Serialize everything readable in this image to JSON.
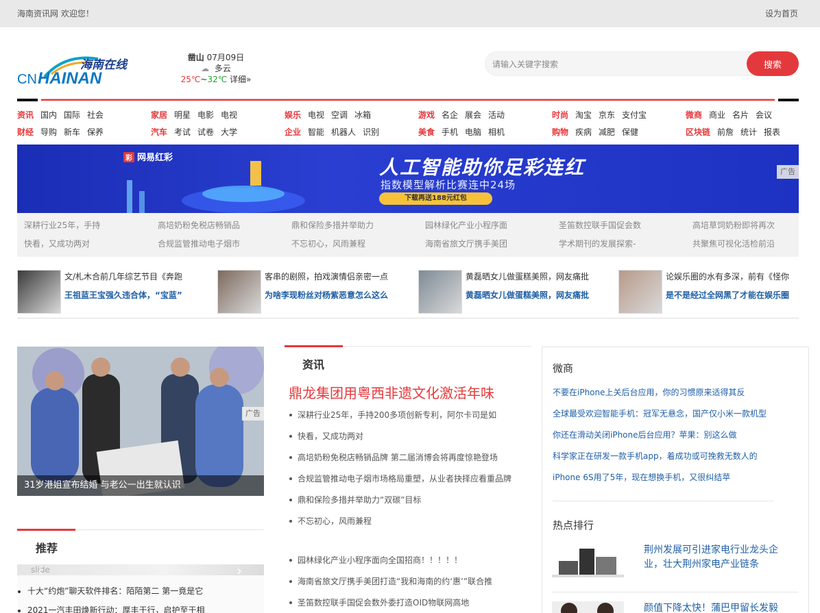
{
  "topbar": {
    "welcome": "海南资讯网  欢迎您！",
    "homepage": "设为首页"
  },
  "logo": {
    "cn": "CN",
    "hainan": "HAINAN",
    "zh": "海南在线"
  },
  "weather": {
    "city": "凿山",
    "date": "07月09日",
    "condition": "多云",
    "low": "25℃",
    "sep": "~",
    "high": "32℃",
    "detail": "详细»"
  },
  "search": {
    "placeholder": "请输入关键字搜索",
    "button": "搜索"
  },
  "nav": [
    {
      "rows": [
        {
          "head": "资讯",
          "items": [
            "国内",
            "国际",
            "社会"
          ]
        },
        {
          "head": "财经",
          "items": [
            "导购",
            "新车",
            "保养"
          ]
        }
      ]
    },
    {
      "rows": [
        {
          "head": "家居",
          "items": [
            "明星",
            "电影",
            "电视"
          ]
        },
        {
          "head": "汽车",
          "items": [
            "考试",
            "试卷",
            "大学"
          ]
        }
      ]
    },
    {
      "rows": [
        {
          "head": "娱乐",
          "items": [
            "电视",
            "空调",
            "冰箱"
          ]
        },
        {
          "head": "企业",
          "items": [
            "智能",
            "机器人",
            "识别"
          ]
        }
      ]
    },
    {
      "rows": [
        {
          "head": "游戏",
          "items": [
            "名企",
            "展会",
            "活动"
          ]
        },
        {
          "head": "美食",
          "items": [
            "手机",
            "电脑",
            "相机"
          ]
        }
      ]
    },
    {
      "rows": [
        {
          "head": "时尚",
          "items": [
            "淘宝",
            "京东",
            "支付宝"
          ]
        },
        {
          "head": "购物",
          "items": [
            "疾病",
            "减肥",
            "保健"
          ]
        }
      ]
    },
    {
      "rows": [
        {
          "head": "微商",
          "items": [
            "商业",
            "名片",
            "会议"
          ]
        },
        {
          "head": "区块链",
          "items": [
            "前詹",
            "统计",
            "报表"
          ]
        }
      ]
    }
  ],
  "banner": {
    "tag": "彩",
    "brand": "网易红彩",
    "headline": "人工智能助你足彩连红",
    "sub": "指数模型解析比赛连中24场",
    "cta": "下载再送188元红包",
    "ad": "广告"
  },
  "links": [
    [
      "深耕行业25年，手持",
      "快看，又成功两对"
    ],
    [
      "高培奶粉免税店畅销品",
      "合规监管推动电子烟市"
    ],
    [
      "鼎和保险多措并举助力",
      "不忘初心，风雨兼程"
    ],
    [
      "园林绿化产业小程序面",
      "海南省旅文厅携手美团"
    ],
    [
      "圣笛数控联手国促会数",
      "学术期刊的发展探索-"
    ],
    [
      "高培草饲奶粉即将再次",
      "共聚焦可视化活检前沿"
    ]
  ],
  "thumbs": [
    {
      "t1": "文/札木合前几年综艺节目《奔跑",
      "t2": "王祖蓝王宝强久违合体，“宝蓝”"
    },
    {
      "t1": "客串的剧照，拍戏演情侣亲密一点",
      "t2": "为啥李现粉丝对杨紫恶意怎么这么"
    },
    {
      "t1": "黄磊晒女儿做蛋糕美照，网友痛批",
      "t2": "黄磊晒女儿做蛋糕美照，网友痛批"
    },
    {
      "t1": "论娱乐圈的水有多深，前有《怪你",
      "t2": "是不是经过全网黑了才能在娱乐圈"
    }
  ],
  "feature": {
    "caption": "31岁港姐宣布结婚 与老公一出生就认识",
    "ad": "广告"
  },
  "recommend": {
    "title": "推荐",
    "slide_alt": "slide",
    "items": [
      "十大“约炮”聊天软件排名：陌陌第二 第一竟是它",
      "2021一汽丰田焕新行动：厚丰于行，启护至于相"
    ]
  },
  "news": {
    "title": "资讯",
    "headline": "鼎龙集团用粤西非遗文化激活年味",
    "list1": [
      "深耕行业25年，手持200多项创新专利，阿尔卡司是如",
      "快看，又成功两对",
      "高培奶粉免税店畅销品牌 第二届消博会将再度惊艳登场",
      "合规监管推动电子烟市场格局重塑，从业者抉择应看重品牌",
      "鼎和保险多措并举助力“双碳”目标",
      "不忘初心，风雨兼程"
    ],
    "list2": [
      "园林绿化产业小程序面向全国招商！！！！！",
      "海南省旅文厅携手美团打造“我和海南的约‘惠’”联合推",
      "圣笛数控联手国促会数外委打造OID物联网高地"
    ]
  },
  "weishang": {
    "title": "微商",
    "items": [
      "不要在iPhone上关后台应用，你的习惯原来适得其反",
      "全球最受欢迎智能手机：冠军无悬念，国产仅小米一款机型",
      "你还在滑动关闭iPhone后台应用？苹果：别这么做",
      "科学家正在研发一款手机app，着成功或可挽救无数人的",
      "iPhone 6S用了5年，现在想换手机，又很纠结苹"
    ]
  },
  "hot": {
    "title": "热点排行",
    "items": [
      "荆州发展可引进家电行业龙头企业，壮大荆州家电产业链条",
      "颜值下降太快！蒲巴甲留长发毅"
    ]
  },
  "colors": {
    "accent": "#e4393c",
    "link": "#1f5fa6",
    "banner": "#2a3fd1"
  }
}
